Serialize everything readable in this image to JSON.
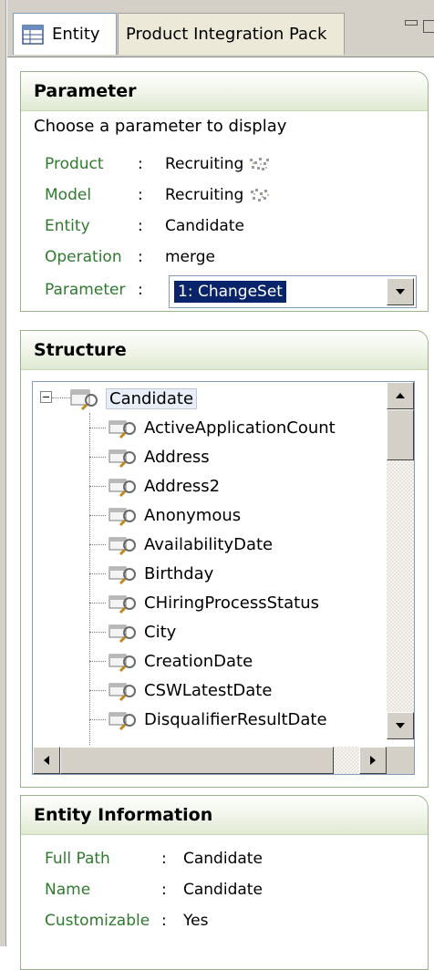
{
  "tabs": [
    {
      "label": "Entity",
      "active": true,
      "icon": "entity-table-icon"
    },
    {
      "label": "Product Integration Pack",
      "active": false
    }
  ],
  "parameter_panel": {
    "title": "Parameter",
    "description": "Choose a parameter to display",
    "rows": [
      {
        "label": "Product",
        "value": "Recruiting",
        "icon": "package-icon"
      },
      {
        "label": "Model",
        "value": "Recruiting",
        "icon": "package-icon"
      },
      {
        "label": "Entity",
        "value": "Candidate"
      },
      {
        "label": "Operation",
        "value": "merge"
      }
    ],
    "parameter_label": "Parameter",
    "parameter_selected": "1: ChangeSet"
  },
  "structure_panel": {
    "title": "Structure",
    "root": "Candidate",
    "children": [
      "ActiveApplicationCount",
      "Address",
      "Address2",
      "Anonymous",
      "AvailabilityDate",
      "Birthday",
      "CHiringProcessStatus",
      "City",
      "CreationDate",
      "CSWLatestDate",
      "DisqualifierResultDate"
    ]
  },
  "entity_info_panel": {
    "title": "Entity Information",
    "rows": [
      {
        "label": "Full Path",
        "value": "Candidate"
      },
      {
        "label": "Name",
        "value": "Candidate"
      },
      {
        "label": "Customizable",
        "value": "Yes"
      }
    ]
  },
  "colors": {
    "label_green": "#2f7a2f",
    "panel_border": "#9bb38a",
    "selection_blue": "#0a246a"
  }
}
